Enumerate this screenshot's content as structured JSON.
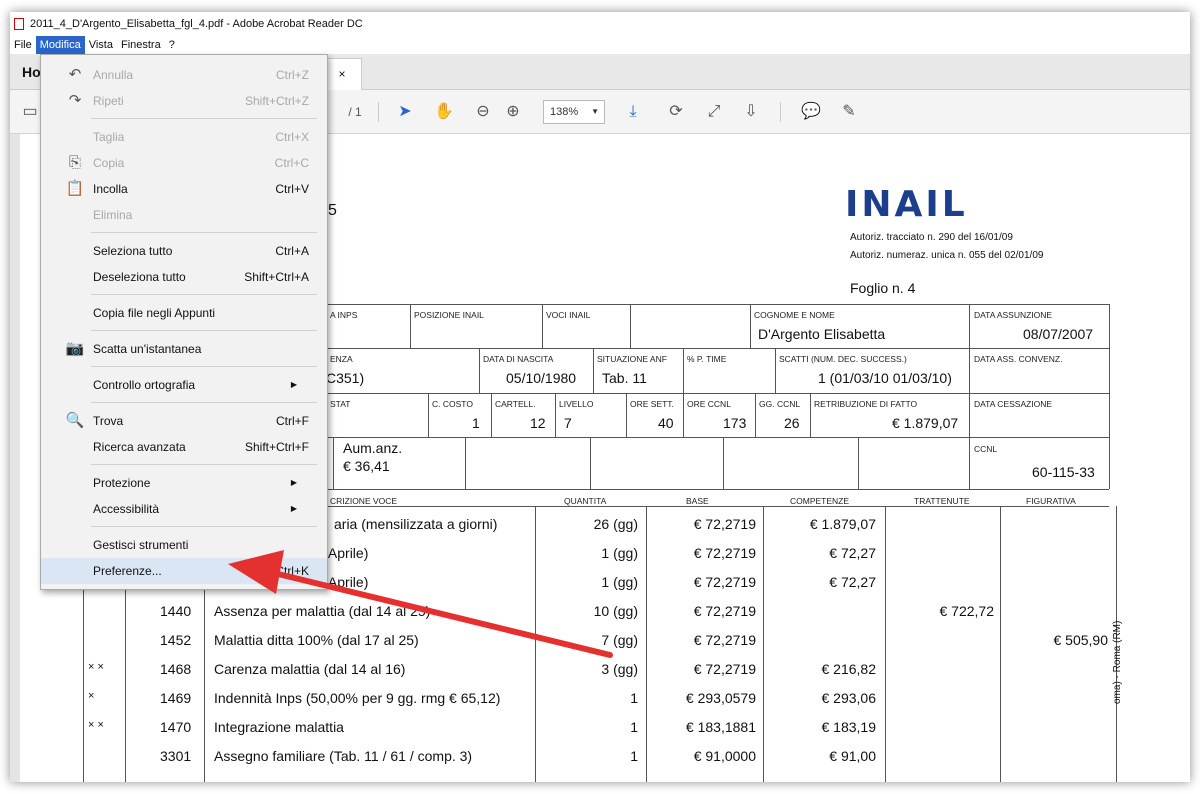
{
  "window": {
    "title": "2011_4_D'Argento_Elisabetta_fgl_4.pdf - Adobe Acrobat Reader DC"
  },
  "menubar": {
    "items": [
      "File",
      "Modifica",
      "Vista",
      "Finestra",
      "?"
    ]
  },
  "tabs": {
    "home": "Ho",
    "close": "×"
  },
  "toolbar": {
    "page_total": "/ 1",
    "zoom": "138%"
  },
  "menu": {
    "undo": {
      "label": "Annulla",
      "key": "Ctrl+Z"
    },
    "redo": {
      "label": "Ripeti",
      "key": "Shift+Ctrl+Z"
    },
    "cut": {
      "label": "Taglia",
      "key": "Ctrl+X"
    },
    "copy": {
      "label": "Copia",
      "key": "Ctrl+C"
    },
    "paste": {
      "label": "Incolla",
      "key": "Ctrl+V"
    },
    "delete": {
      "label": "Elimina",
      "key": ""
    },
    "select_all": {
      "label": "Seleziona tutto",
      "key": "Ctrl+A"
    },
    "deselect_all": {
      "label": "Deseleziona tutto",
      "key": "Shift+Ctrl+A"
    },
    "copy_file": {
      "label": "Copia file negli Appunti",
      "key": ""
    },
    "snapshot": {
      "label": "Scatta un'istantanea",
      "key": ""
    },
    "spelling": {
      "label": "Controllo ortografia",
      "key": ""
    },
    "find": {
      "label": "Trova",
      "key": "Ctrl+F"
    },
    "adv_search": {
      "label": "Ricerca avanzata",
      "key": "Shift+Ctrl+F"
    },
    "protection": {
      "label": "Protezione",
      "key": ""
    },
    "accessibility": {
      "label": "Accessibilità",
      "key": ""
    },
    "manage_tools": {
      "label": "Gestisci strumenti",
      "key": ""
    },
    "preferences": {
      "label": "Preferenze...",
      "key": "Ctrl+K"
    }
  },
  "doc": {
    "logo": "INAIL",
    "partial_5": "5",
    "auth1": "Autoriz. tracciato n. 290 del 16/01/09",
    "auth2": "Autoriz. numeraz. unica n. 055 del 02/01/09",
    "foglio": "Foglio n.  4",
    "h": {
      "inps": "A INPS",
      "pos_inail": "POSIZIONE INAIL",
      "voci_inail": "VOCI INAIL",
      "cognome_lbl": "COGNOME E NOME",
      "cognome": "D'Argento Elisabetta",
      "data_ass_lbl": "DATA  ASSUNZIONE",
      "data_ass": "08/07/2007",
      "enza": "ENZA",
      "c351": "C351)",
      "nascita_lbl": "DATA DI NASCITA",
      "nascita": "05/10/1980",
      "anf_lbl": "SITUAZIONE ANF",
      "anf": "Tab. 11",
      "ptime_lbl": "% P. TIME",
      "scatti_lbl": "SCATTI  (NUM. DEC. SUCCESS.)",
      "scatti": "1 (01/03/10 01/03/10)",
      "ass_conv_lbl": "DATA ASS. CONVENZ.",
      "stat": "STAT",
      "costo_lbl": "C. COSTO",
      "costo": "1",
      "cartell_lbl": "CARTELL.",
      "cartell": "12",
      "livello_lbl": "LIVELLO",
      "livello": "7",
      "oresett_lbl": "ORE SETT.",
      "oresett": "40",
      "oreccnl_lbl": "ORE CCNL",
      "oreccnl": "173",
      "ggccnl_lbl": "GG. CCNL",
      "ggccnl": "26",
      "retr_lbl": "RETRIBUZIONE DI FATTO",
      "retr": "€ 1.879,07",
      "cess_lbl": "DATA CESSAZIONE",
      "aumanz": "Aum.anz.",
      "aumanz_val": "€ 36,41",
      "ccnl_lbl": "CCNL",
      "ccnl": "60-115-33",
      "descr": "CRIZIONE VOCE",
      "qta": "QUANTITA",
      "base": "BASE",
      "comp": "COMPETENZE",
      "tratt": "TRATTENUTE",
      "fig": "FIGURATIVA"
    },
    "rows": [
      {
        "flag": "",
        "code": "",
        "desc": "aria (mensilizzata a giorni)",
        "qta": "26 (gg)",
        "base": "€ 72,2719",
        "comp": "€ 1.879,07",
        "tratt": "",
        "fig": ""
      },
      {
        "flag": "",
        "code": "",
        "desc": "5 Aprile)",
        "qta": "1 (gg)",
        "base": "€ 72,2719",
        "comp": "€ 72,27",
        "tratt": "",
        "fig": ""
      },
      {
        "flag": "",
        "code": "",
        "desc": "5 Aprile)",
        "qta": "1 (gg)",
        "base": "€ 72,2719",
        "comp": "€ 72,27",
        "tratt": "",
        "fig": ""
      },
      {
        "flag": "",
        "code": "1440",
        "desc": "Assenza per malattia (dal 14 al 25)",
        "qta": "10 (gg)",
        "base": "€ 72,2719",
        "comp": "",
        "tratt": "€ 722,72",
        "fig": ""
      },
      {
        "flag": "",
        "code": "1452",
        "desc": "Malattia ditta 100% (dal 17 al 25)",
        "qta": "7 (gg)",
        "base": "€ 72,2719",
        "comp": "",
        "tratt": "",
        "fig": "€ 505,90"
      },
      {
        "flag": "× ×",
        "code": "1468",
        "desc": "Carenza malattia (dal 14 al 16)",
        "qta": "3 (gg)",
        "base": "€ 72,2719",
        "comp": "€ 216,82",
        "tratt": "",
        "fig": ""
      },
      {
        "flag": "×",
        "code": "1469",
        "desc": "Indennità Inps (50,00% per 9 gg. rmg € 65,12)",
        "qta": "1",
        "base": "€ 293,0579",
        "comp": "€ 293,06",
        "tratt": "",
        "fig": ""
      },
      {
        "flag": "× ×",
        "code": "1470",
        "desc": "Integrazione malattia",
        "qta": "1",
        "base": "€ 183,1881",
        "comp": "€ 183,19",
        "tratt": "",
        "fig": ""
      },
      {
        "flag": "",
        "code": "3301",
        "desc": "Assegno familiare (Tab. 11 / 61 / comp. 3)",
        "qta": "1",
        "base": "€ 91,0000",
        "comp": "€ 91,00",
        "tratt": "",
        "fig": ""
      }
    ],
    "sidetext": "oma) - Roma (RM)"
  },
  "colors": {
    "accent": "#2a66c9",
    "logo": "#1c3f8c",
    "arrow": "#e53030",
    "menu_highlight": "#dbe6f5"
  }
}
